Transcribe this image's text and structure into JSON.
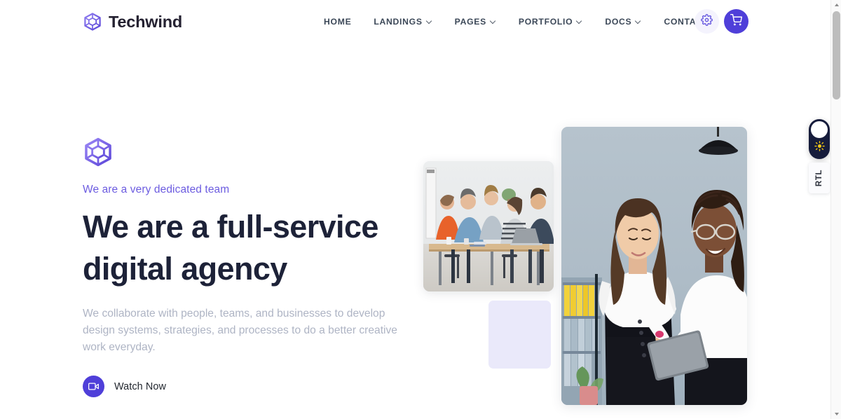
{
  "header": {
    "brand": {
      "name": "Techwind",
      "logo_icon": "techwind-hexagon-cube-logo"
    },
    "nav": [
      {
        "label": "HOME",
        "has_dropdown": false
      },
      {
        "label": "LANDINGS",
        "has_dropdown": true
      },
      {
        "label": "PAGES",
        "has_dropdown": true
      },
      {
        "label": "PORTFOLIO",
        "has_dropdown": true
      },
      {
        "label": "DOCS",
        "has_dropdown": true
      },
      {
        "label": "CONTACT",
        "has_dropdown": false
      }
    ],
    "actions": {
      "settings_icon": "gear-icon",
      "cart_icon": "shopping-cart-icon"
    }
  },
  "hero": {
    "logo_icon": "techwind-hexagon-cube-logo",
    "eyebrow": "We are a very dedicated team",
    "headline": "We are a full-service digital agency",
    "description": "We collaborate with people, teams, and businesses to develop design systems, strategies, and processes to do a better creative work everyday.",
    "cta": {
      "label": "Watch Now",
      "icon": "video-camera-icon"
    },
    "media": {
      "small_image_alt": "Team of five colleagues collaborating around a desk with a laptop",
      "large_image_alt": "Two businesswomen in white shirts looking at a tablet in an office",
      "placeholder_alt": "Empty image placeholder"
    }
  },
  "floating": {
    "mode_toggle": {
      "name": "dark-light-mode-toggle",
      "state": "light",
      "icon": "sun-icon"
    },
    "rtl_switch": {
      "label": "RTL"
    }
  },
  "colors": {
    "accent": "#4f3fd9",
    "accent_soft": "#6c5ce0",
    "headline": "#1d2238",
    "body_text": "#aeb4c4",
    "nav_text": "#3c4858",
    "placeholder": "#eae9fa",
    "toggle_bg": "#161c3b",
    "sun": "#f6c915"
  }
}
